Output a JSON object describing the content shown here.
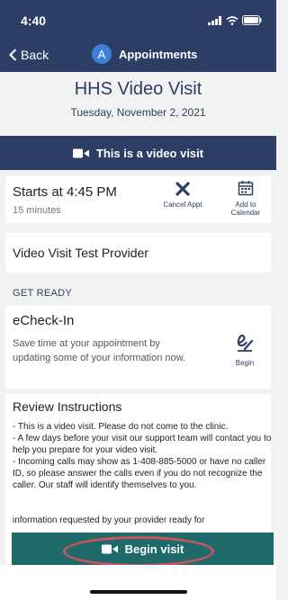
{
  "status_bar": {
    "time": "4:40"
  },
  "nav": {
    "back_label": "Back",
    "avatar_letter": "A",
    "title": "Appointments"
  },
  "visit": {
    "title": "HHS Video Visit",
    "date": "Tuesday, November 2, 2021"
  },
  "video_banner": {
    "label": "This is a video visit"
  },
  "appointment": {
    "starts_text": "Starts at 4:45 PM",
    "duration": "15 minutes",
    "cancel_label": "Cancel Appt",
    "add_calendar_label": "Add to Calendar"
  },
  "provider": {
    "name": "Video Visit Test Provider"
  },
  "get_ready": {
    "heading": "GET READY"
  },
  "echeck": {
    "title": "eCheck-In",
    "description": "Save time at your appointment by updating some of your information now.",
    "begin_label": "Begin"
  },
  "instructions": {
    "title": "Review Instructions",
    "lines": [
      "- This is a video visit.  Please do not come to the clinic.",
      "- A few days before your visit our support team will contact you to help you prepare for your video visit.",
      "- Incoming calls may show as 1-408-885-5000 or have no caller ID, so please answer the calls even if you do not recognize the caller. Our staff will identify themselves to you.",
      "information requested by your provider ready for"
    ]
  },
  "begin_visit": {
    "label": "Begin visit"
  },
  "colors": {
    "navy": "#2c3e66",
    "teal_button": "#1f6b6b",
    "highlight_red": "#c9545a",
    "avatar_blue": "#3f7fd8"
  }
}
